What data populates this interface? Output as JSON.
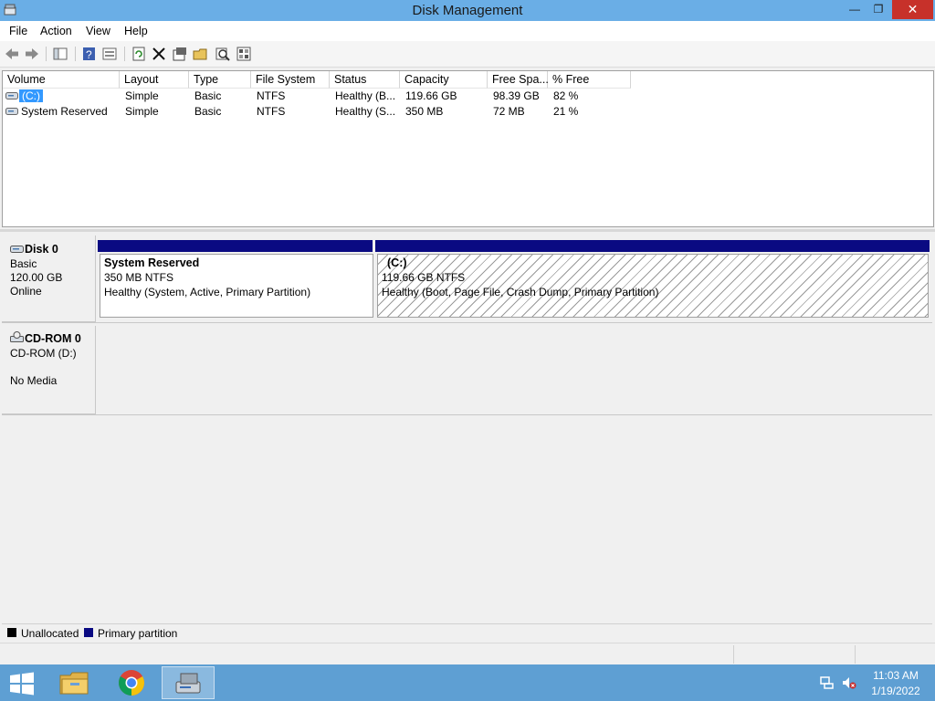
{
  "window": {
    "title": "Disk Management",
    "close_glyph": "✕",
    "minimize_glyph": "—",
    "restore_glyph": "❐"
  },
  "menu": [
    "File",
    "Action",
    "View",
    "Help"
  ],
  "toolbar_icons": [
    "back-icon",
    "forward-icon",
    "show-hide-console-tree-icon",
    "help-icon",
    "properties-list-icon",
    "refresh-icon",
    "delete-icon",
    "properties-icon",
    "open-icon",
    "rescan-icon",
    "settings-icon"
  ],
  "volume_list": {
    "columns": [
      "Volume",
      "Layout",
      "Type",
      "File System",
      "Status",
      "Capacity",
      "Free Spa...",
      "% Free"
    ],
    "rows": [
      {
        "volume": "(C:)",
        "layout": "Simple",
        "type": "Basic",
        "fs": "NTFS",
        "status": "Healthy (B...",
        "capacity": "119.66 GB",
        "free": "98.39 GB",
        "pct": "82 %",
        "selected": true
      },
      {
        "volume": "System Reserved",
        "layout": "Simple",
        "type": "Basic",
        "fs": "NTFS",
        "status": "Healthy (S...",
        "capacity": "350 MB",
        "free": "72 MB",
        "pct": "21 %",
        "selected": false
      }
    ]
  },
  "disks": [
    {
      "name": "Disk 0",
      "type": "Basic",
      "size": "120.00 GB",
      "state": "Online",
      "partitions": [
        {
          "name": "System Reserved",
          "size": "350 MB NTFS",
          "status": "Healthy (System, Active, Primary Partition)"
        },
        {
          "name": "(C:)",
          "size": "119.66 GB NTFS",
          "status": "Healthy (Boot, Page File, Crash Dump, Primary Partition)"
        }
      ]
    },
    {
      "name": "CD-ROM 0",
      "type": "CD-ROM (D:)",
      "state": "No Media"
    }
  ],
  "legend": [
    {
      "label": "Unallocated",
      "color": "#000000"
    },
    {
      "label": "Primary partition",
      "color": "#0a0a82"
    }
  ],
  "taskbar": {
    "apps": [
      "windows-start-icon",
      "file-explorer-icon",
      "chrome-icon",
      "disk-management-icon"
    ],
    "clock_time": "11:03 AM",
    "clock_date": "1/19/2022"
  },
  "colors": {
    "titlebar": "#6aaee6",
    "taskbar": "#5e9fd3",
    "selection": "#3399ff",
    "partition_bar": "#0a0a82",
    "close": "#c7312a"
  }
}
